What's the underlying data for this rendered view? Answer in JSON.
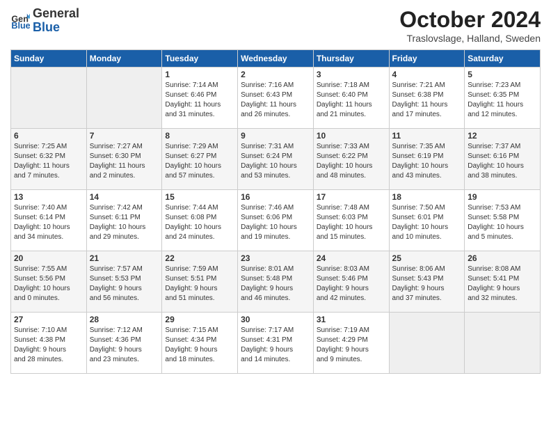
{
  "logo": {
    "line1": "General",
    "line2": "Blue"
  },
  "header": {
    "month": "October 2024",
    "location": "Traslovslage, Halland, Sweden"
  },
  "weekdays": [
    "Sunday",
    "Monday",
    "Tuesday",
    "Wednesday",
    "Thursday",
    "Friday",
    "Saturday"
  ],
  "weeks": [
    [
      {
        "day": "",
        "content": ""
      },
      {
        "day": "",
        "content": ""
      },
      {
        "day": "1",
        "content": "Sunrise: 7:14 AM\nSunset: 6:46 PM\nDaylight: 11 hours\nand 31 minutes."
      },
      {
        "day": "2",
        "content": "Sunrise: 7:16 AM\nSunset: 6:43 PM\nDaylight: 11 hours\nand 26 minutes."
      },
      {
        "day": "3",
        "content": "Sunrise: 7:18 AM\nSunset: 6:40 PM\nDaylight: 11 hours\nand 21 minutes."
      },
      {
        "day": "4",
        "content": "Sunrise: 7:21 AM\nSunset: 6:38 PM\nDaylight: 11 hours\nand 17 minutes."
      },
      {
        "day": "5",
        "content": "Sunrise: 7:23 AM\nSunset: 6:35 PM\nDaylight: 11 hours\nand 12 minutes."
      }
    ],
    [
      {
        "day": "6",
        "content": "Sunrise: 7:25 AM\nSunset: 6:32 PM\nDaylight: 11 hours\nand 7 minutes."
      },
      {
        "day": "7",
        "content": "Sunrise: 7:27 AM\nSunset: 6:30 PM\nDaylight: 11 hours\nand 2 minutes."
      },
      {
        "day": "8",
        "content": "Sunrise: 7:29 AM\nSunset: 6:27 PM\nDaylight: 10 hours\nand 57 minutes."
      },
      {
        "day": "9",
        "content": "Sunrise: 7:31 AM\nSunset: 6:24 PM\nDaylight: 10 hours\nand 53 minutes."
      },
      {
        "day": "10",
        "content": "Sunrise: 7:33 AM\nSunset: 6:22 PM\nDaylight: 10 hours\nand 48 minutes."
      },
      {
        "day": "11",
        "content": "Sunrise: 7:35 AM\nSunset: 6:19 PM\nDaylight: 10 hours\nand 43 minutes."
      },
      {
        "day": "12",
        "content": "Sunrise: 7:37 AM\nSunset: 6:16 PM\nDaylight: 10 hours\nand 38 minutes."
      }
    ],
    [
      {
        "day": "13",
        "content": "Sunrise: 7:40 AM\nSunset: 6:14 PM\nDaylight: 10 hours\nand 34 minutes."
      },
      {
        "day": "14",
        "content": "Sunrise: 7:42 AM\nSunset: 6:11 PM\nDaylight: 10 hours\nand 29 minutes."
      },
      {
        "day": "15",
        "content": "Sunrise: 7:44 AM\nSunset: 6:08 PM\nDaylight: 10 hours\nand 24 minutes."
      },
      {
        "day": "16",
        "content": "Sunrise: 7:46 AM\nSunset: 6:06 PM\nDaylight: 10 hours\nand 19 minutes."
      },
      {
        "day": "17",
        "content": "Sunrise: 7:48 AM\nSunset: 6:03 PM\nDaylight: 10 hours\nand 15 minutes."
      },
      {
        "day": "18",
        "content": "Sunrise: 7:50 AM\nSunset: 6:01 PM\nDaylight: 10 hours\nand 10 minutes."
      },
      {
        "day": "19",
        "content": "Sunrise: 7:53 AM\nSunset: 5:58 PM\nDaylight: 10 hours\nand 5 minutes."
      }
    ],
    [
      {
        "day": "20",
        "content": "Sunrise: 7:55 AM\nSunset: 5:56 PM\nDaylight: 10 hours\nand 0 minutes."
      },
      {
        "day": "21",
        "content": "Sunrise: 7:57 AM\nSunset: 5:53 PM\nDaylight: 9 hours\nand 56 minutes."
      },
      {
        "day": "22",
        "content": "Sunrise: 7:59 AM\nSunset: 5:51 PM\nDaylight: 9 hours\nand 51 minutes."
      },
      {
        "day": "23",
        "content": "Sunrise: 8:01 AM\nSunset: 5:48 PM\nDaylight: 9 hours\nand 46 minutes."
      },
      {
        "day": "24",
        "content": "Sunrise: 8:03 AM\nSunset: 5:46 PM\nDaylight: 9 hours\nand 42 minutes."
      },
      {
        "day": "25",
        "content": "Sunrise: 8:06 AM\nSunset: 5:43 PM\nDaylight: 9 hours\nand 37 minutes."
      },
      {
        "day": "26",
        "content": "Sunrise: 8:08 AM\nSunset: 5:41 PM\nDaylight: 9 hours\nand 32 minutes."
      }
    ],
    [
      {
        "day": "27",
        "content": "Sunrise: 7:10 AM\nSunset: 4:38 PM\nDaylight: 9 hours\nand 28 minutes."
      },
      {
        "day": "28",
        "content": "Sunrise: 7:12 AM\nSunset: 4:36 PM\nDaylight: 9 hours\nand 23 minutes."
      },
      {
        "day": "29",
        "content": "Sunrise: 7:15 AM\nSunset: 4:34 PM\nDaylight: 9 hours\nand 18 minutes."
      },
      {
        "day": "30",
        "content": "Sunrise: 7:17 AM\nSunset: 4:31 PM\nDaylight: 9 hours\nand 14 minutes."
      },
      {
        "day": "31",
        "content": "Sunrise: 7:19 AM\nSunset: 4:29 PM\nDaylight: 9 hours\nand 9 minutes."
      },
      {
        "day": "",
        "content": ""
      },
      {
        "day": "",
        "content": ""
      }
    ]
  ]
}
